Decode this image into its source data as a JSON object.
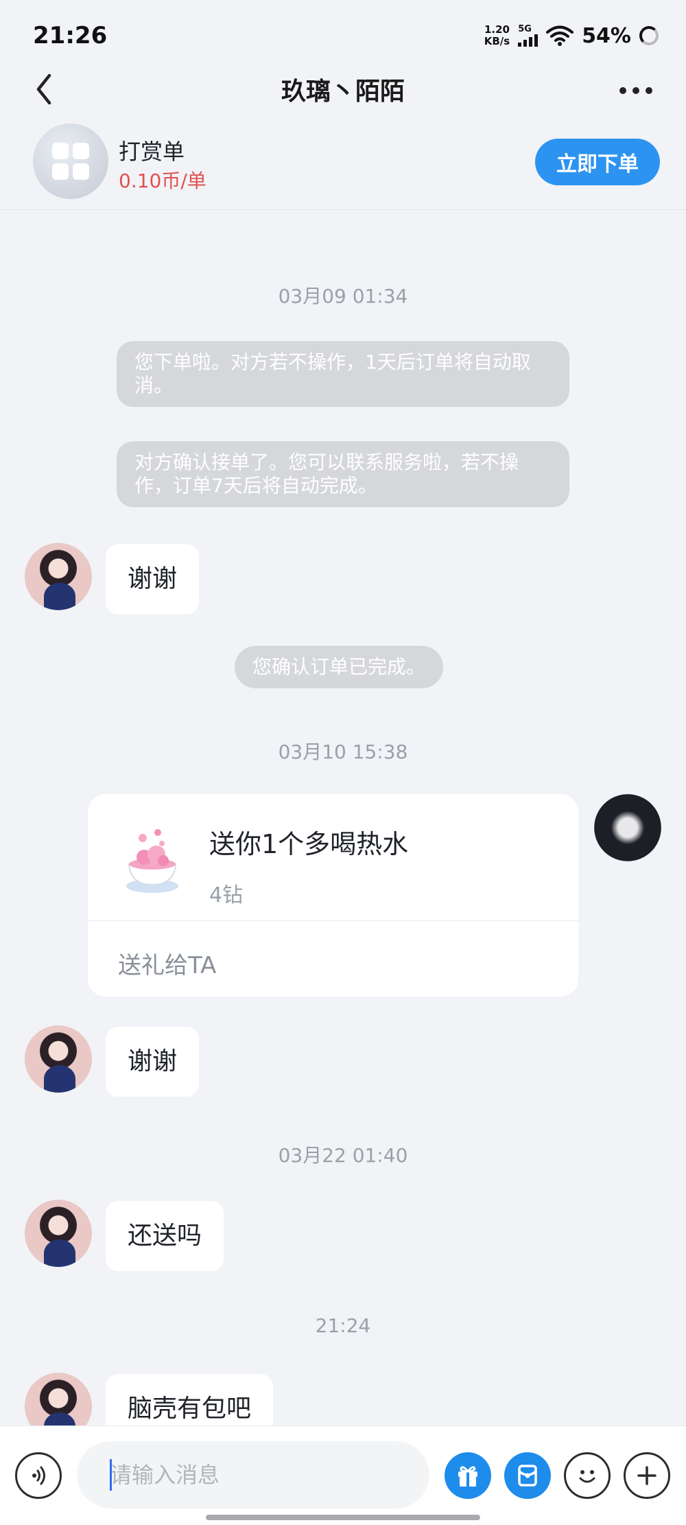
{
  "status_bar": {
    "time": "21:26",
    "net_speed_value": "1.20",
    "net_speed_unit": "KB/s",
    "network": "5G",
    "battery": "54%"
  },
  "nav": {
    "title": "玖璃丶陌陌",
    "back_icon": "chevron-left-icon",
    "more_icon": "more-dots-icon"
  },
  "order": {
    "title": "打赏单",
    "price": "0.10币/单",
    "button": "立即下单",
    "price_color": "#e0504f",
    "button_color": "#2d93f0"
  },
  "chat": {
    "timestamps": [
      "03月09 01:34",
      "03月10 15:38",
      "03月22 01:40",
      "21:24"
    ],
    "system_messages": [
      "您下单啦。对方若不操作，1天后订单将自动取消。",
      "对方确认接单了。您可以联系服务啦，若不操作，订单7天后将自动完成。",
      "您确认订单已完成。"
    ],
    "messages": [
      "谢谢",
      "谢谢",
      "还送吗",
      "脑壳有包吧"
    ],
    "gift": {
      "title": "送你1个多喝热水",
      "price": "4钻",
      "action": "送礼给TA"
    }
  },
  "input": {
    "placeholder": "请输入消息",
    "voice_icon": "voice-icon",
    "gift_icon": "gift-icon",
    "bag_icon": "red-packet-icon",
    "emoji_icon": "emoji-icon",
    "plus_icon": "plus-icon"
  }
}
